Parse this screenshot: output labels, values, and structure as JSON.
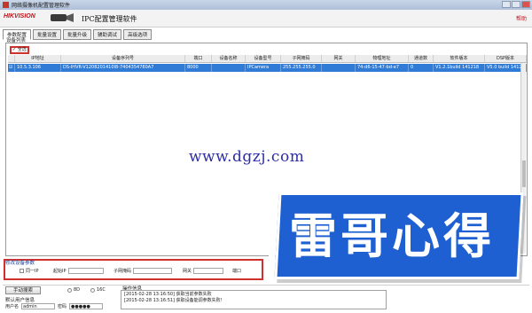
{
  "window": {
    "title": "网络摄像机配置管理软件"
  },
  "banner": {
    "logo": "HIKVISION",
    "app_title": "IPC配置管理软件",
    "help": "帮助"
  },
  "tabs": [
    {
      "label": "参数配置",
      "active": true
    },
    {
      "label": "批量设置"
    },
    {
      "label": "批量升级"
    },
    {
      "label": "辅助调试"
    },
    {
      "label": "高级选项"
    }
  ],
  "device_list": {
    "label": "设备列表",
    "select_all": "全选",
    "columns": [
      "",
      "IP地址",
      "设备序列号",
      "端口",
      "设备名称",
      "设备型号",
      "子网掩码",
      "网关",
      "物理地址",
      "通道数",
      "软件版本",
      "DSP版本"
    ],
    "rows": [
      [
        "",
        "10.5.3.106",
        "DS-IHVR-V1208201410I8-7404354780A7",
        "8000",
        "",
        "IPCamera",
        "255.255.255.0",
        "",
        "74-d6-15-47-bd-e7",
        "0",
        "V1.2.1build 141218",
        "V5.0 build 1412"
      ]
    ]
  },
  "watermark": "www.dgzj.com",
  "modify": {
    "title": "修改设备参数",
    "same_ip_label": "同一IP",
    "start_ip_label": "起始IP",
    "mask_label": "子网掩码",
    "gateway_label": "网关",
    "port_label": "端口"
  },
  "bottom": {
    "manual_search": "手动搜索",
    "radio_8d": "8D",
    "radio_16c": "16C",
    "login_section": "默认用户信息",
    "username_label": "用户名",
    "username_value": "admin",
    "password_label": "密码",
    "password_value": "●●●●●",
    "log_label": "操作信息",
    "log_lines": [
      "[2015-02-28 13:16:50] 获取当前参数失败",
      "[2015-02-28 13:16:51] 获取设备能调参数失败!"
    ]
  },
  "badge": "雷哥心得",
  "colors": {
    "selection": "#2f7bd6",
    "highlight_box": "#d0312d",
    "badge": "#1e5fd1"
  }
}
